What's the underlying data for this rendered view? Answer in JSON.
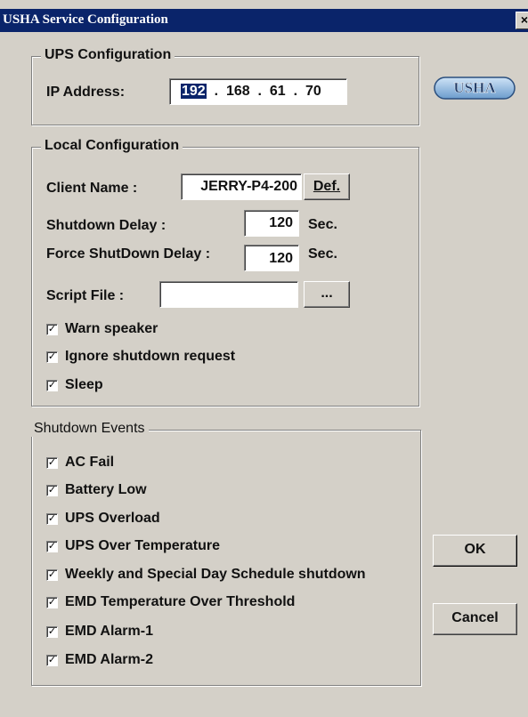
{
  "window": {
    "title": "USHA Service Configuration",
    "close_glyph": "×"
  },
  "logo": {
    "text": "USHA"
  },
  "ups_config": {
    "legend": "UPS Configuration",
    "ip_label": "IP Address:",
    "ip": [
      "192",
      "168",
      "61",
      "70"
    ]
  },
  "local_config": {
    "legend": "Local Configuration",
    "client_name_label": "Client Name :",
    "client_name_value": "JERRY-P4-200",
    "def_button": "Def.",
    "shutdown_delay_label": "Shutdown Delay :",
    "shutdown_delay_value": "120",
    "shutdown_delay_unit": "Sec.",
    "force_delay_label": "Force ShutDown Delay :",
    "force_delay_value": "120",
    "force_delay_unit": "Sec.",
    "script_label": "Script File :",
    "script_value": "",
    "browse_button": "...",
    "options": [
      {
        "label": "Warn speaker",
        "checked": true
      },
      {
        "label": "Ignore shutdown request",
        "checked": true
      },
      {
        "label": "Sleep",
        "checked": true
      }
    ]
  },
  "events": {
    "legend": "Shutdown Events",
    "items": [
      {
        "label": "AC Fail",
        "checked": true
      },
      {
        "label": "Battery Low",
        "checked": true
      },
      {
        "label": "UPS Overload",
        "checked": true
      },
      {
        "label": "UPS Over Temperature",
        "checked": true
      },
      {
        "label": "Weekly and Special Day Schedule shutdown",
        "checked": true
      },
      {
        "label": "EMD Temperature Over Threshold",
        "checked": true
      },
      {
        "label": "EMD Alarm-1",
        "checked": true
      },
      {
        "label": "EMD Alarm-2",
        "checked": true
      }
    ]
  },
  "buttons": {
    "ok": "OK",
    "cancel": "Cancel"
  },
  "check_glyph": "✓"
}
